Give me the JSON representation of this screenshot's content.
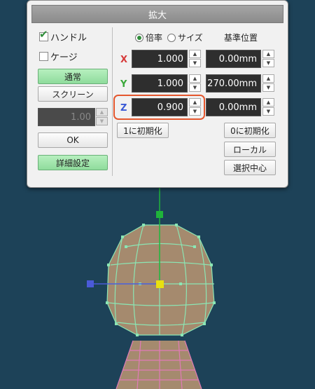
{
  "dialog": {
    "title": "拡大",
    "handle_label": "ハンドル",
    "handle_checked": true,
    "cage_label": "ケージ",
    "cage_checked": false,
    "mode_normal": "通常",
    "mode_screen": "スクリーン",
    "screen_value": "1.00",
    "ok": "OK",
    "details": "詳細設定",
    "radio_ratio": "倍率",
    "radio_size": "サイズ",
    "ratio_selected": true,
    "ref_pos_header": "基準位置",
    "axes": [
      {
        "name": "X",
        "ratio": "1.000",
        "pos": "0.00mm",
        "color": "#d63a3a"
      },
      {
        "name": "Y",
        "ratio": "1.000",
        "pos": "270.00mm",
        "color": "#3aa83a"
      },
      {
        "name": "Z",
        "ratio": "0.900",
        "pos": "0.00mm",
        "color": "#3a5ad6"
      }
    ],
    "reset_one": "1に初期化",
    "reset_zero": "0に初期化",
    "local": "ローカル",
    "selection_center": "選択中心"
  },
  "viewport": {
    "background": "#1d4258",
    "head_color": "#a58a6e",
    "body_color": "#a58a6e",
    "wire_head": "#8be6b4",
    "wire_body": "#e07bb7",
    "gizmo_x": "#4b5ad8",
    "gizmo_y": "#1fb43a",
    "gizmo_center": "#e8e010"
  }
}
